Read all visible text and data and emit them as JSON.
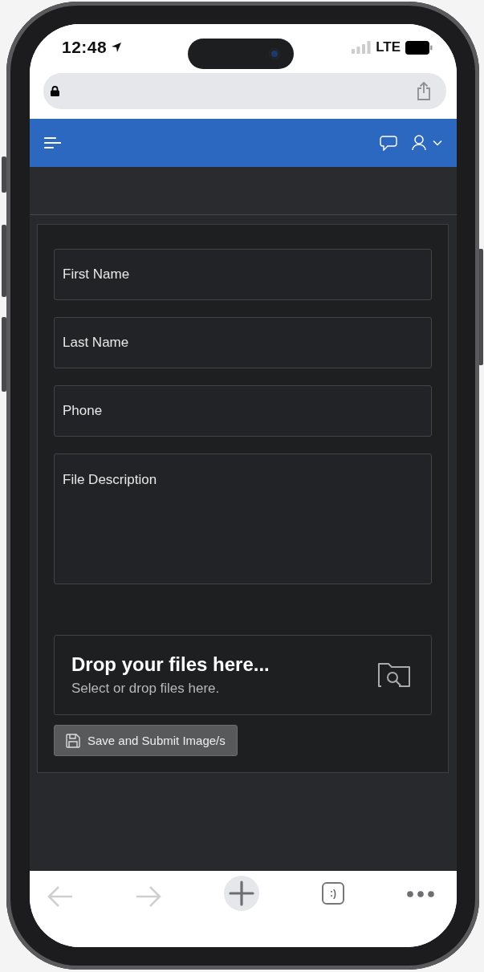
{
  "status_bar": {
    "time": "12:48",
    "network": "LTE"
  },
  "form": {
    "fields": [
      {
        "kind": "input",
        "placeholder": "First Name"
      },
      {
        "kind": "input",
        "placeholder": "Last Name"
      },
      {
        "kind": "input",
        "placeholder": "Phone"
      },
      {
        "kind": "textarea",
        "placeholder": "File Description"
      }
    ],
    "dropzone": {
      "title": "Drop your files here...",
      "subtitle": "Select or drop files here."
    },
    "submit_button": {
      "label": "Save and Submit Image/s"
    }
  },
  "browser_toolbar": {
    "back": {
      "disabled": true
    },
    "forward": {
      "disabled": true
    },
    "tabs_label": ":)"
  }
}
